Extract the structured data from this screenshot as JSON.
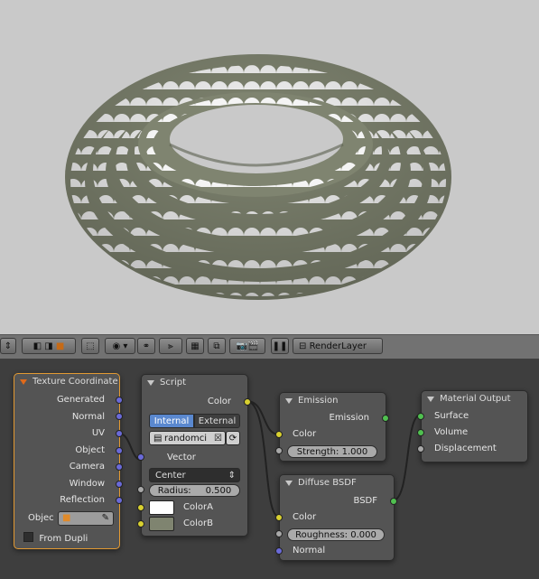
{
  "toolbar": {
    "render_layer_label": "RenderLayer"
  },
  "nodes": {
    "texture_coordinate": {
      "title": "Texture Coordinate",
      "outputs": [
        "Generated",
        "Normal",
        "UV",
        "Object",
        "Camera",
        "Window",
        "Reflection"
      ],
      "object_label": "Objec",
      "from_dupli_label": "From Dupli"
    },
    "script": {
      "title": "Script",
      "output_color": "Color",
      "mode_internal": "Internal",
      "mode_external": "External",
      "script_name": "randomci",
      "vector_label": "Vector",
      "center_option": "Center",
      "radius_label": "Radius:",
      "radius_value": "0.500",
      "color_a_label": "ColorA",
      "color_b_label": "ColorB",
      "color_a": "#ffffff",
      "color_b": "#7f8470"
    },
    "emission": {
      "title": "Emission",
      "output": "Emission",
      "color_label": "Color",
      "strength_label": "Strength:",
      "strength_value": "1.000"
    },
    "diffuse": {
      "title": "Diffuse BSDF",
      "output": "BSDF",
      "color_label": "Color",
      "roughness_label": "Roughness:",
      "roughness_value": "0.000",
      "normal_label": "Normal"
    },
    "material_output": {
      "title": "Material Output",
      "surface": "Surface",
      "volume": "Volume",
      "displacement": "Displacement"
    }
  },
  "colors": {
    "torus_body": "#7f8470",
    "torus_pattern": "#ffffff",
    "viewport_bg": "#c9c9c9",
    "active_node_border": "#e39a32"
  }
}
